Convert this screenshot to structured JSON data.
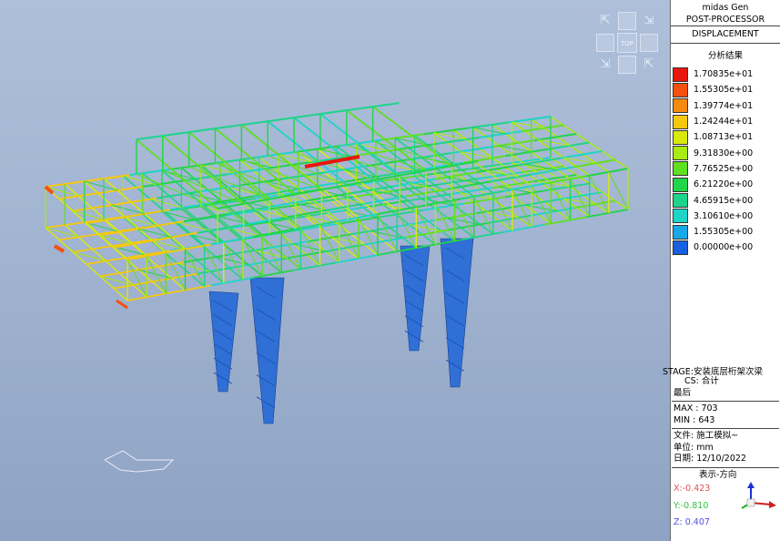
{
  "viewcube": {
    "top_label": "TOP"
  },
  "panel": {
    "app_title": "midas Gen",
    "subtitle": "POST-PROCESSOR",
    "result_type": "DISPLACEMENT",
    "legend_title": "分析结果"
  },
  "legend": [
    {
      "value": "1.70835e+01",
      "color": "#e8160b"
    },
    {
      "value": "1.55305e+01",
      "color": "#f5500f"
    },
    {
      "value": "1.39774e+01",
      "color": "#f58a0f"
    },
    {
      "value": "1.24244e+01",
      "color": "#f5c80f"
    },
    {
      "value": "1.08713e+01",
      "color": "#d9e80f"
    },
    {
      "value": "9.31830e+00",
      "color": "#a8ea12"
    },
    {
      "value": "7.76525e+00",
      "color": "#5fe020"
    },
    {
      "value": "6.21220e+00",
      "color": "#22d44a"
    },
    {
      "value": "4.65915e+00",
      "color": "#1ed48a"
    },
    {
      "value": "3.10610e+00",
      "color": "#1ed4c8"
    },
    {
      "value": "1.55305e+00",
      "color": "#18a8e8"
    },
    {
      "value": "0.00000e+00",
      "color": "#1860e0"
    }
  ],
  "info": {
    "stage": "STAGE:安装底层桁架次梁",
    "cs": "CS: 合计",
    "step": "最后",
    "max": "MAX : 703",
    "min": "MIN : 643",
    "file": "文件: 施工模拟~",
    "unit": "单位: mm",
    "date": "日期: 12/10/2022",
    "direction_title": "表示-方向",
    "x_dir": "X:-0.423",
    "y_dir": "Y:-0.810",
    "z_dir": "Z: 0.407"
  }
}
